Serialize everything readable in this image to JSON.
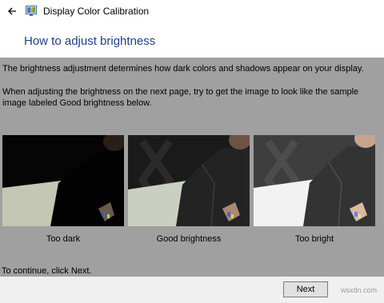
{
  "window": {
    "title": "Display Color Calibration",
    "back_icon": "back-arrow-icon",
    "app_icon": "display-calibration-icon"
  },
  "page": {
    "heading": "How to adjust brightness",
    "paragraph1": "The brightness adjustment determines how dark colors and shadows appear on your display.",
    "paragraph2": "When adjusting the brightness on the next page, try to get the image to look like the sample image labeled Good brightness below."
  },
  "samples": [
    {
      "caption": "Too dark"
    },
    {
      "caption": "Good brightness"
    },
    {
      "caption": "Too bright"
    }
  ],
  "footer": {
    "continue_text": "To continue, click Next.",
    "next_label": "Next",
    "watermark": "wsxdn.com"
  },
  "colors": {
    "heading": "#1e3f8a",
    "background": "#a0a0a0"
  }
}
